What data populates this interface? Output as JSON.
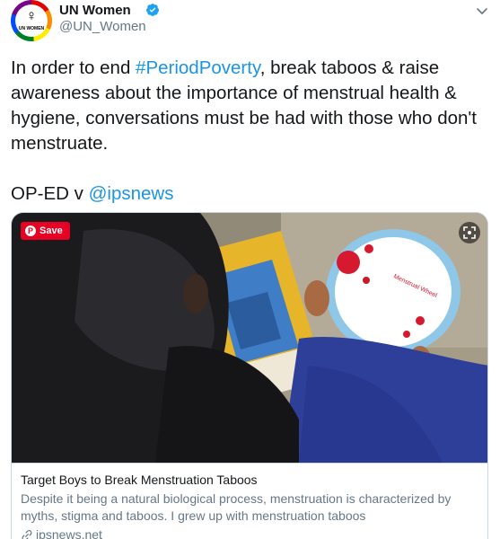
{
  "account": {
    "display_name": "UN Women",
    "handle": "@UN_Women",
    "avatar_label": "UN WOMEN",
    "verified_icon": "verified-badge-icon"
  },
  "tweet": {
    "text_before": "In order to end ",
    "hashtag": "#PeriodPoverty",
    "text_after": ", break taboos & raise awareness about the importance of menstrual health & hygiene, conversations must be had with those who don't menstruate.",
    "oped_prefix": "OP-ED v ",
    "mention": "@ipsnews"
  },
  "card": {
    "save_label": "Save",
    "title": "Target Boys to Break Menstruation Taboos",
    "description": "Despite it being a natural biological process, menstruation is characterized by myths, stigma and taboos. I grew up with menstruation taboos",
    "domain": "ipsnews.net",
    "disc_text": "Menstrual Wheel"
  },
  "colors": {
    "link": "#1b95e0",
    "pinterest": "#e60023",
    "verified": "#1da1f2"
  }
}
